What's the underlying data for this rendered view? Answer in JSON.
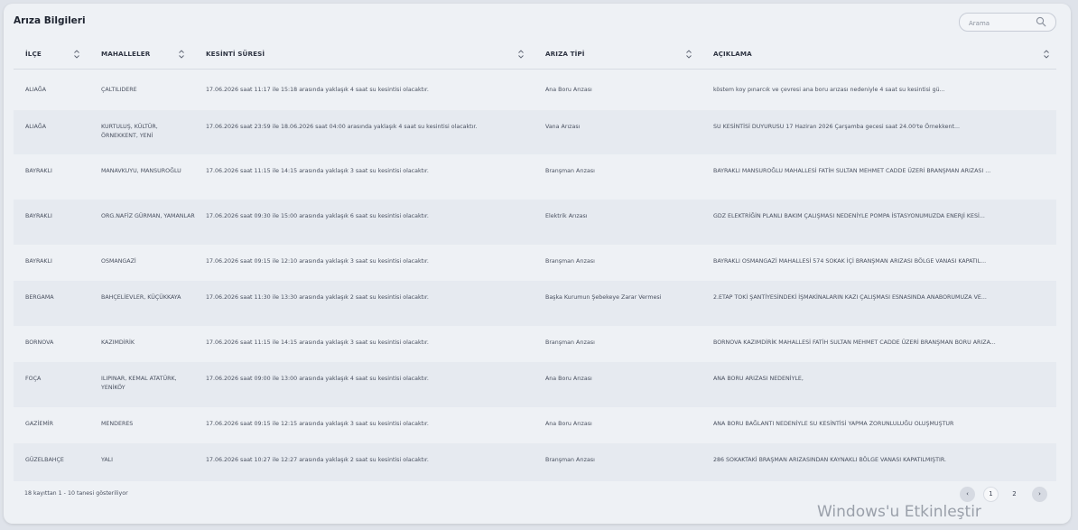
{
  "card": {
    "title": "Arıza Bilgileri"
  },
  "search": {
    "placeholder": "Arama"
  },
  "table": {
    "columns": [
      "İLÇE",
      "MAHALLELER",
      "KESİNTİ SÜRESİ",
      "ARIZA TİPİ",
      "AÇIKLAMA"
    ],
    "rows": [
      {
        "ilce": "ALIAĞA",
        "mahalle": "ÇALTILIDERE",
        "sure": "17.06.2026 saat 11:17 ile 15:18 arasında yaklaşık 4 saat su kesintisi olacaktır.",
        "tip": "Ana Boru Arızası",
        "aciklama": "köstem koy pınarcık ve çevresi ana boru arızası nedeniyle 4 saat su kesintisi gü..."
      },
      {
        "ilce": "ALIAĞA",
        "mahalle": "KURTULUŞ, KÜLTÜR, ÖRNEKKENT, YENİ",
        "sure": "17.06.2026 saat 23:59 ile 18.06.2026 saat 04:00 arasında yaklaşık 4 saat su kesintisi olacaktır.",
        "tip": "Vana Arızası",
        "aciklama": "SU KESİNTİSİ DUYURUSU 17 Haziran 2026 Çarşamba gecesi saat 24.00'te Örnekkent..."
      },
      {
        "ilce": "BAYRAKLI",
        "mahalle": "MANAVKUYU, MANSUROĞLU",
        "sure": "17.06.2026 saat 11:15 ile 14:15 arasında yaklaşık 3 saat su kesintisi olacaktır.",
        "tip": "Branşman Arızası",
        "aciklama": "BAYRAKLI MANSUROĞLU MAHALLESİ FATİH SULTAN MEHMET CADDE ÜZERİ BRANŞMAN ARIZASI ..."
      },
      {
        "ilce": "BAYRAKLI",
        "mahalle": "ORG.NAFİZ GÜRMAN, YAMANLAR",
        "sure": "17.06.2026 saat 09:30 ile 15:00 arasında yaklaşık 6 saat su kesintisi olacaktır.",
        "tip": "Elektrik Arızası",
        "aciklama": "GDZ ELEKTRİĞİN PLANLI BAKIM ÇALIŞMASI NEDENİYLE POMPA İSTASYONUMUZDA ENERJİ KESİ..."
      },
      {
        "ilce": "BAYRAKLI",
        "mahalle": "OSMANGAZİ",
        "sure": "17.06.2026 saat 09:15 ile 12:10 arasında yaklaşık 3 saat su kesintisi olacaktır.",
        "tip": "Branşman Arızası",
        "aciklama": "BAYRAKLI OSMANGAZİ MAHALLESİ 574 SOKAK İÇİ BRANŞMAN ARIZASI BÖLGE VANASI KAPATIL..."
      },
      {
        "ilce": "BERGAMA",
        "mahalle": "BAHÇELİEVLER, KÜÇÜKKAYA",
        "sure": "17.06.2026 saat 11:30 ile 13:30 arasında yaklaşık 2 saat su kesintisi olacaktır.",
        "tip": "Başka Kurumun Şebekeye Zarar Vermesi",
        "aciklama": "2.ETAP TOKİ ŞANTİYESİNDEKİ İŞMAKİNALARIN KAZI ÇALIŞMASI ESNASINDA ANABORUMUZA VE..."
      },
      {
        "ilce": "BORNOVA",
        "mahalle": "KAZIMDİRİK",
        "sure": "17.06.2026 saat 11:15 ile 14:15 arasında yaklaşık 3 saat su kesintisi olacaktır.",
        "tip": "Branşman Arızası",
        "aciklama": "BORNOVA KAZIMDİRİK MAHALLESİ FATİH SULTAN MEHMET CADDE ÜZERİ BRANŞMAN BORU ARIZA..."
      },
      {
        "ilce": "FOÇA",
        "mahalle": "ILIPINAR, KEMAL ATATÜRK, YENİKÖY",
        "sure": "17.06.2026 saat 09:00 ile 13:00 arasında yaklaşık 4 saat su kesintisi olacaktır.",
        "tip": "Ana Boru Arızası",
        "aciklama": "ANA BORU ARIZASI NEDENİYLE,"
      },
      {
        "ilce": "GAZİEMİR",
        "mahalle": "MENDERES",
        "sure": "17.06.2026 saat 09:15 ile 12:15 arasında yaklaşık 3 saat su kesintisi olacaktır.",
        "tip": "Ana Boru Arızası",
        "aciklama": "ANA BORU BAĞLANTI NEDENİYLE SU KESİNTİSİ YAPMA ZORUNLULUĞU OLUŞMUŞTUR"
      },
      {
        "ilce": "GÜZELBAHÇE",
        "mahalle": "YALI",
        "sure": "17.06.2026 saat 10:27 ile 12:27 arasında yaklaşık 2 saat su kesintisi olacaktır.",
        "tip": "Branşman Arızası",
        "aciklama": "286 SOKAKTAKİ BRAŞMAN ARIZASINDAN KAYNAKLI BÖLGE VANASI KAPATILMIŞTIR."
      }
    ]
  },
  "footer": {
    "info": "18 kayıttan 1 - 10 tanesi gösteriliyor"
  },
  "pagination": {
    "prev": "‹",
    "pages": [
      "1",
      "2"
    ],
    "current": "1",
    "next": "›"
  },
  "watermark": "Windows'u Etkinleştir"
}
